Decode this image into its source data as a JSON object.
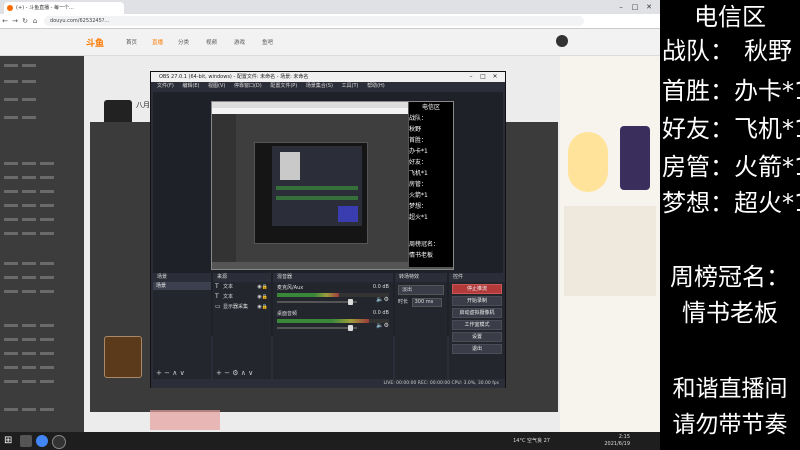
{
  "browser": {
    "tab_title": "(+) - 斗鱼直播 - 每一个...",
    "url": "douyu.com/6253245?..."
  },
  "site": {
    "logo": "斗鱼",
    "nav": [
      "首页",
      "直播",
      "分类",
      "视频",
      "游戏",
      "鱼吧"
    ],
    "streamer_name": "八月"
  },
  "obs": {
    "title": "OBS 27.0.1 (64-bit, windows) - 配置文件: 未命名 - 场景: 未命名",
    "menu": [
      "文件(F)",
      "编辑(E)",
      "视图(V)",
      "停靠窗口(D)",
      "配置文件(P)",
      "场景集合(S)",
      "工具(T)",
      "帮助(H)"
    ],
    "docks": {
      "scenes": "场景",
      "sources": "来源",
      "mixer": "混音器",
      "transitions": "转场特效",
      "controls": "控件"
    },
    "scenes": [
      "场景"
    ],
    "sources": [
      {
        "icon": "T",
        "name": "文本"
      },
      {
        "icon": "T",
        "name": "文本"
      },
      {
        "icon": "▭",
        "name": "显示器采集"
      }
    ],
    "mixer": [
      {
        "name": "桌面音频",
        "db": "0.0 dB",
        "level": 0.82,
        "vol": 0.95
      },
      {
        "name": "麦克风/Aux",
        "db": "0.0 dB",
        "level": 0.55,
        "vol": 0.95
      }
    ],
    "transition": {
      "selected": "淡出",
      "duration_label": "时长",
      "duration": "300 ms"
    },
    "controls": [
      "停止推流",
      "开始录制",
      "启动虚拟摄像机",
      "工作室模式",
      "设置",
      "退出"
    ],
    "status": "LIVE: 00:00:00   REC: 00:00:00   CPU: 3.0%, 30.00 fps"
  },
  "overlay": {
    "region": "电信区",
    "lines": [
      {
        "label": "战队：",
        "value": "秋野"
      },
      {
        "label": "首胜：",
        "value": "办卡*1"
      },
      {
        "label": "好友：",
        "value": "飞机*1"
      },
      {
        "label": "房管：",
        "value": "火箭*1"
      },
      {
        "label": "梦想：",
        "value": "超火*1"
      }
    ],
    "crown_label": "周榜冠名：",
    "crown_name": "情书老板",
    "notice1": "和谐直播间",
    "notice2": "请勿带节奏"
  },
  "taskbar": {
    "weather": "14°C  空气良 27",
    "time": "2:15",
    "date": "2021/6/19"
  }
}
